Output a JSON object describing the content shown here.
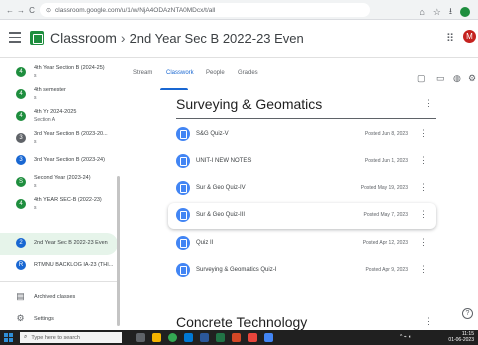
{
  "browser": {
    "url": "classroom.google.com/u/1/w/NjA4ODAzNTA0MDcx/t/all",
    "nav": {
      "back": "←",
      "forward": "→",
      "reload": "C"
    }
  },
  "header": {
    "app_name": "Classroom",
    "separator": "›",
    "class_name": "2nd Year Sec B 2022-23 Even",
    "avatar_letter": "M"
  },
  "sidebar": {
    "items": [
      {
        "avatar": "4",
        "title": "4th Year Section B (2024-25)",
        "subtitle": "s",
        "color": "#1e8e3e"
      },
      {
        "avatar": "4",
        "title": "4th semester",
        "subtitle": "s",
        "color": "#1e8e3e"
      },
      {
        "avatar": "4",
        "title": "4th Yr 2024-2025",
        "subtitle": "Section A",
        "color": "#1e8e3e"
      },
      {
        "avatar": "3",
        "title": "3rd Year Section B (2023-20...",
        "subtitle": "s",
        "color": "#5f6368"
      },
      {
        "avatar": "3",
        "title": "3rd Year Section B (2023-24)",
        "subtitle": "",
        "color": "#1967d2"
      },
      {
        "avatar": "S",
        "title": "Second Year (2023-24)",
        "subtitle": "s",
        "color": "#1e8e3e"
      },
      {
        "avatar": "4",
        "title": "4th YEAR SEC-B (2022-23)",
        "subtitle": "s",
        "color": "#1e8e3e"
      },
      {
        "avatar": "2",
        "title": "2nd Year Sec B 2022-23 Even",
        "subtitle": "",
        "color": "#1967d2"
      },
      {
        "avatar": "R",
        "title": "RTMNU BACKLOG IA-23 (THI...",
        "subtitle": "",
        "color": "#1967d2"
      }
    ],
    "archived_label": "Archived classes",
    "settings_label": "Settings"
  },
  "tabs": [
    "Stream",
    "Classwork",
    "People",
    "Grades"
  ],
  "sections": [
    {
      "title": "Surveying & Geomatics",
      "items": [
        {
          "title": "S&G Quiz-V",
          "date": "Posted Jun 8, 2023"
        },
        {
          "title": "UNIT-I NEW NOTES",
          "date": "Posted Jun 1, 2023"
        },
        {
          "title": "Sur & Geo Quiz-IV",
          "date": "Posted May 19, 2023"
        },
        {
          "title": "Sur & Geo Quiz-III",
          "date": "Posted May 7, 2023"
        },
        {
          "title": "Quiz II",
          "date": "Posted Apr 12, 2023"
        },
        {
          "title": "Surveying & Geomatics Quiz-I",
          "date": "Posted Apr 9, 2023"
        }
      ]
    },
    {
      "title": "Concrete Technology",
      "items": []
    }
  ],
  "taskbar": {
    "search_placeholder": "Type here to search",
    "time": "11:15",
    "date": "01-06-2023"
  },
  "icons": {
    "more": "⋮",
    "apps": "⠿",
    "help": "?"
  }
}
